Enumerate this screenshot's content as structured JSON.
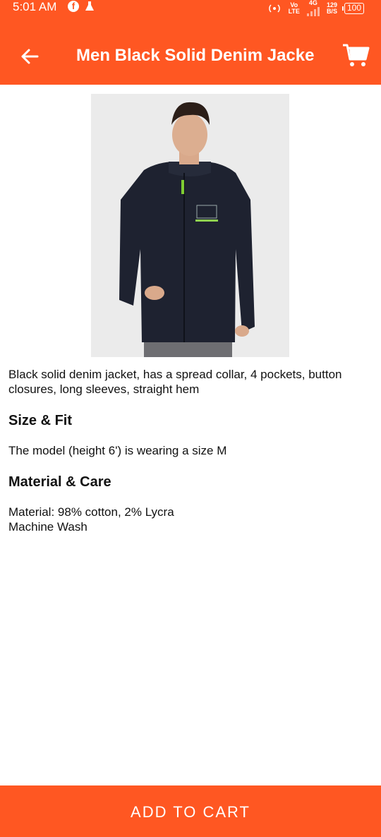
{
  "status_bar": {
    "time": "5:01 AM",
    "vo_lte_top": "Vo",
    "vo_lte_bottom": "LTE",
    "network": "4G",
    "speed_top": "129",
    "speed_bottom": "B/S",
    "battery": "100"
  },
  "app_bar": {
    "title": "Men Black Solid Denim Jacke"
  },
  "product": {
    "description": "Black solid denim jacket, has a spread collar, 4 pockets, button closures, long sleeves, straight hem",
    "size_fit_title": "Size & Fit",
    "size_fit_text": "The model (height 6') is wearing a size M",
    "material_title": "Material & Care",
    "material_line1": "Material: 98% cotton, 2% Lycra",
    "material_line2": "Machine Wash"
  },
  "actions": {
    "add_to_cart": "ADD TO CART"
  },
  "colors": {
    "primary": "#ff5722",
    "jacket": "#1e2230",
    "image_bg": "#ebebeb"
  }
}
